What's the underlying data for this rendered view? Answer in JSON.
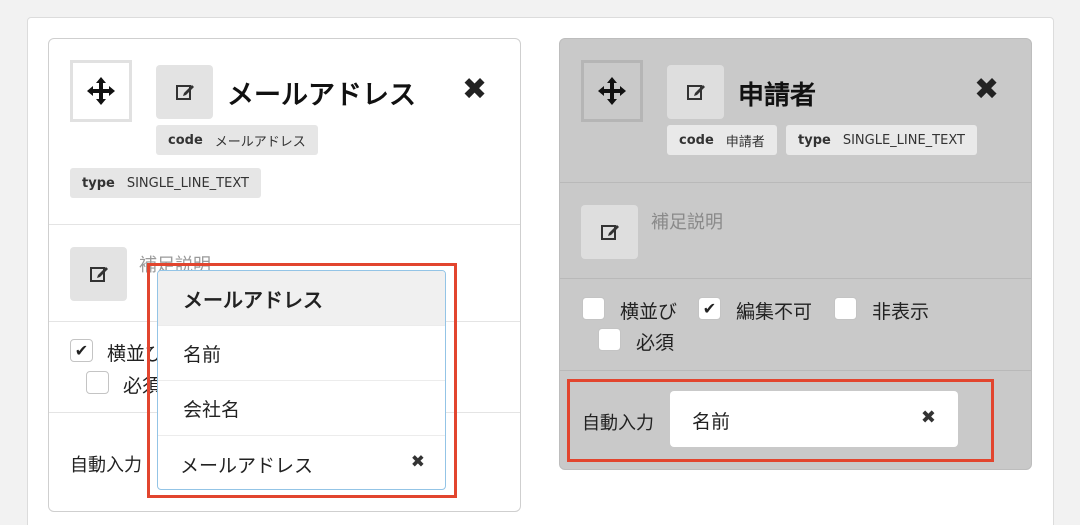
{
  "left_card": {
    "title": "メールアドレス",
    "code_key": "code",
    "code_value": "メールアドレス",
    "type_key": "type",
    "type_value": "SINGLE_LINE_TEXT",
    "description_placeholder": "補足説明",
    "checkboxes": [
      {
        "label": "横並び",
        "checked": true
      },
      {
        "label": "必須",
        "checked": false
      }
    ],
    "auto_input_label": "自動入力",
    "dropdown": {
      "options": [
        "メールアドレス",
        "名前",
        "会社名"
      ],
      "highlighted_option": "メールアドレス",
      "selected_value": "メールアドレス"
    }
  },
  "right_card": {
    "title": "申請者",
    "code_key": "code",
    "code_value": "申請者",
    "type_key": "type",
    "type_value": "SINGLE_LINE_TEXT",
    "description_placeholder": "補足説明",
    "checkboxes": [
      {
        "label": "横並び",
        "checked": false
      },
      {
        "label": "編集不可",
        "checked": true
      },
      {
        "label": "非表示",
        "checked": false
      },
      {
        "label": "必須",
        "checked": false
      }
    ],
    "auto_input_label": "自動入力",
    "auto_input_value": "名前"
  },
  "icons": {
    "move": "move-arrows-icon",
    "edit": "edit-pencil-icon",
    "close": "close-x-icon",
    "check": "checkmark-icon",
    "clear": "clear-x-icon"
  },
  "colors": {
    "highlight": "#e2452e",
    "disabled_card": "#c9c9c9",
    "dropdown_border": "#93c4e6"
  }
}
